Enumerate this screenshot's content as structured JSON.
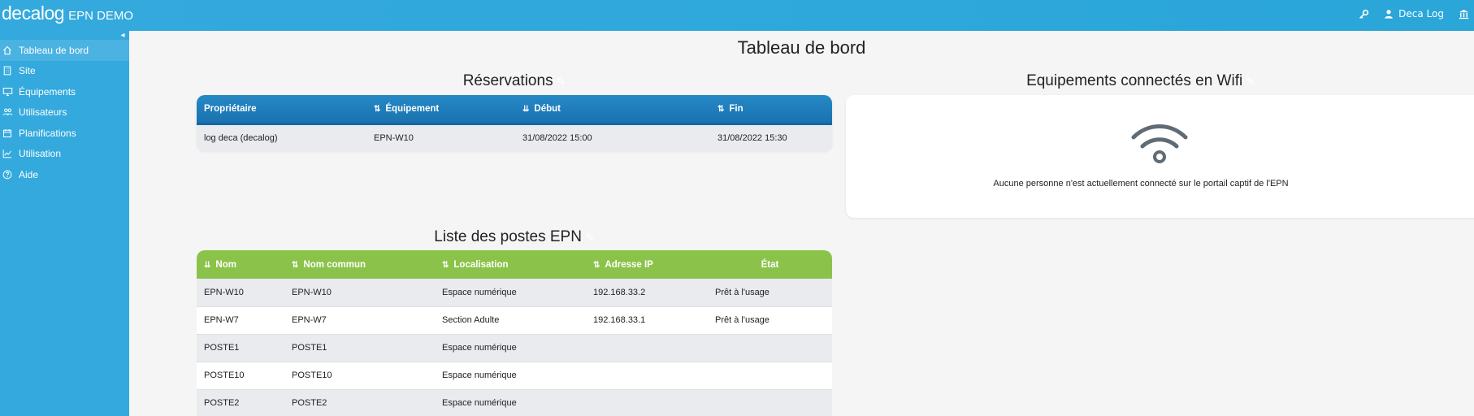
{
  "header": {
    "brand_logo": "decalog",
    "app_name": "EPN DEMO",
    "user_name": "Deca Log",
    "icons": [
      "key-icon",
      "user-icon",
      "bank-icon"
    ]
  },
  "sidebar": {
    "collapse_glyph": "◂",
    "items": [
      {
        "label": "Tableau de bord",
        "icon": "home-icon",
        "active": true
      },
      {
        "label": "Site",
        "icon": "building-icon"
      },
      {
        "label": "Équipements",
        "icon": "monitor-icon"
      },
      {
        "label": "Utilisateurs",
        "icon": "users-icon"
      },
      {
        "label": "Planifications",
        "icon": "calendar-icon"
      },
      {
        "label": "Utilisation",
        "icon": "chart-icon"
      },
      {
        "label": "Aide",
        "icon": "help-icon"
      }
    ]
  },
  "main": {
    "title": "Tableau de bord",
    "reservations": {
      "title": "Réservations",
      "columns": [
        {
          "label": "Propriétaire",
          "sort": ""
        },
        {
          "label": "Équipement",
          "sort": "⇅"
        },
        {
          "label": "Début",
          "sort": "⇊"
        },
        {
          "label": "Fin",
          "sort": "⇅"
        }
      ],
      "rows": [
        [
          "log deca (decalog)",
          "EPN-W10",
          "31/08/2022 15:00",
          "31/08/2022 15:30"
        ]
      ]
    },
    "wifi": {
      "title": "Equipements connectés en Wifi",
      "message": "Aucune personne n'est actuellement connecté sur le portail captif de l'EPN"
    },
    "postes": {
      "title": "Liste des postes EPN",
      "columns": [
        {
          "label": "Nom",
          "sort": "⇊"
        },
        {
          "label": "Nom commun",
          "sort": "⇅"
        },
        {
          "label": "Localisation",
          "sort": "⇅"
        },
        {
          "label": "Adresse IP",
          "sort": "⇅"
        },
        {
          "label": "État",
          "sort": ""
        }
      ],
      "rows": [
        [
          "EPN-W10",
          "EPN-W10",
          "Espace numérique",
          "192.168.33.2",
          "Prêt à l'usage"
        ],
        [
          "EPN-W7",
          "EPN-W7",
          "Section Adulte",
          "192.168.33.1",
          "Prêt à l'usage"
        ],
        [
          "POSTE1",
          "POSTE1",
          "Espace numérique",
          "",
          ""
        ],
        [
          "POSTE10",
          "POSTE10",
          "Espace numérique",
          "",
          ""
        ],
        [
          "POSTE2",
          "POSTE2",
          "Espace numérique",
          "",
          ""
        ]
      ]
    }
  },
  "colors": {
    "header_bg": "#2aa6d9",
    "sidebar_bg": "#34a9dd",
    "reservations_header": "#1e7dbd",
    "postes_header": "#8bc34a",
    "wifi_icon": "#5f6b75"
  }
}
